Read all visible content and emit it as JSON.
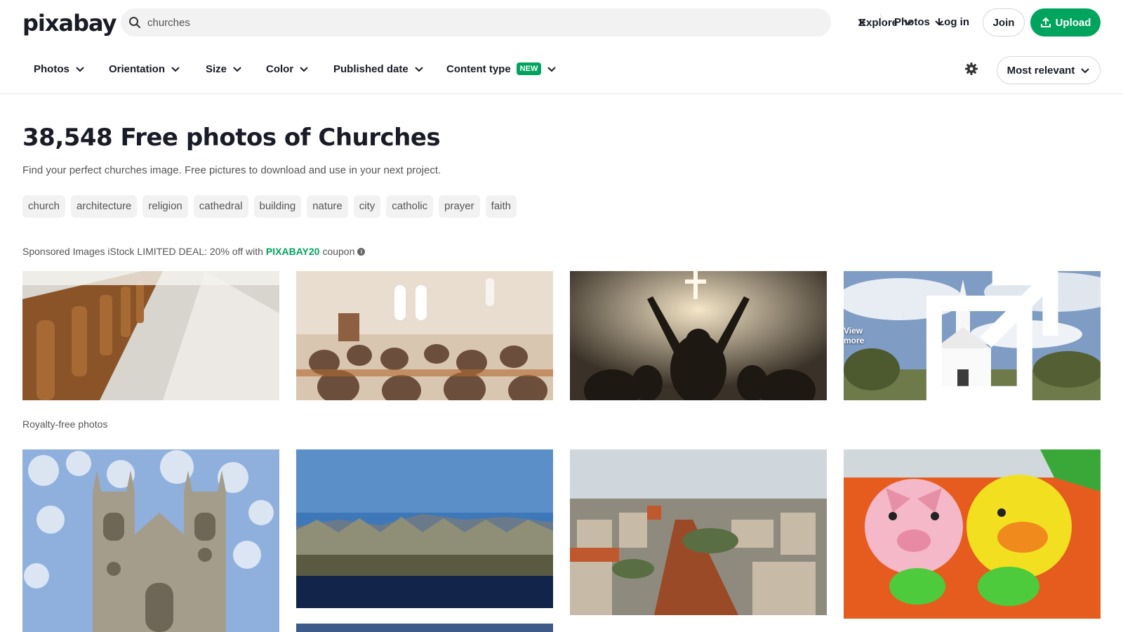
{
  "header": {
    "logo": "pixabay",
    "search_value": "churches",
    "search_type": "Photos",
    "explore": "Explore",
    "login": "Log in",
    "join": "Join",
    "upload": "Upload"
  },
  "filters": {
    "photos": "Photos",
    "orientation": "Orientation",
    "size": "Size",
    "color": "Color",
    "published_date": "Published date",
    "content_type": "Content type",
    "new_badge": "NEW",
    "sort": "Most relevant"
  },
  "main": {
    "title": "38,548 Free photos of Churches",
    "subtitle": "Find your perfect churches image. Free pictures to download and use in your next project.",
    "tags": [
      "church",
      "architecture",
      "religion",
      "cathedral",
      "building",
      "nature",
      "city",
      "catholic",
      "prayer",
      "faith"
    ]
  },
  "sponsored": {
    "text": "Sponsored Images iStock LIMITED DEAL: 20% off with",
    "coupon_code": "PIXABAY20",
    "coupon_suffix": "coupon",
    "view_more": "View more"
  },
  "royalty_free": {
    "label": "Royalty-free photos"
  },
  "colors": {
    "accent": "#00a45d",
    "text": "#191b26"
  }
}
